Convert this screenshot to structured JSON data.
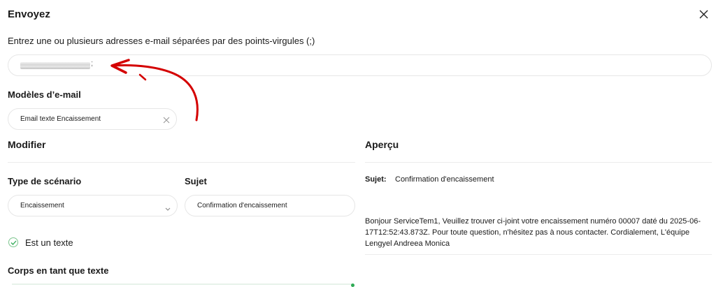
{
  "dialog": {
    "title": "Envoyez"
  },
  "recipients": {
    "instruction": "Entrez une ou plusieurs adresses e-mail séparées par des points-virgules (;)",
    "separator": ";"
  },
  "templates": {
    "label": "Modèles d’e-mail",
    "selected": "Email texte Encaissement"
  },
  "edit": {
    "heading": "Modifier",
    "scenario_label": "Type de scénario",
    "scenario_value": "Encaissement",
    "subject_label": "Sujet",
    "subject_value": "Confirmation d'encaissement",
    "is_text_label": "Est un texte",
    "body_label": "Corps en tant que texte"
  },
  "preview": {
    "heading": "Aperçu",
    "subject_label": "Sujet:",
    "subject_value": "Confirmation d'encaissement",
    "body": "Bonjour ServiceTem1, Veuillez trouver ci-joint votre encaissement numéro 00007 daté du 2025-06-17T12:52:43.873Z. Pour toute question, n'hésitez pas à nous contacter. Cordialement, L'équipe Lengyel Andreea Monica"
  },
  "colors": {
    "annotation_arrow": "#d40000",
    "check_green": "#2eaa55",
    "border": "#e6e6e6"
  },
  "icons": {
    "close": "close-icon",
    "clear": "clear-icon",
    "chevron": "chevron-down-icon",
    "check": "check-icon"
  }
}
